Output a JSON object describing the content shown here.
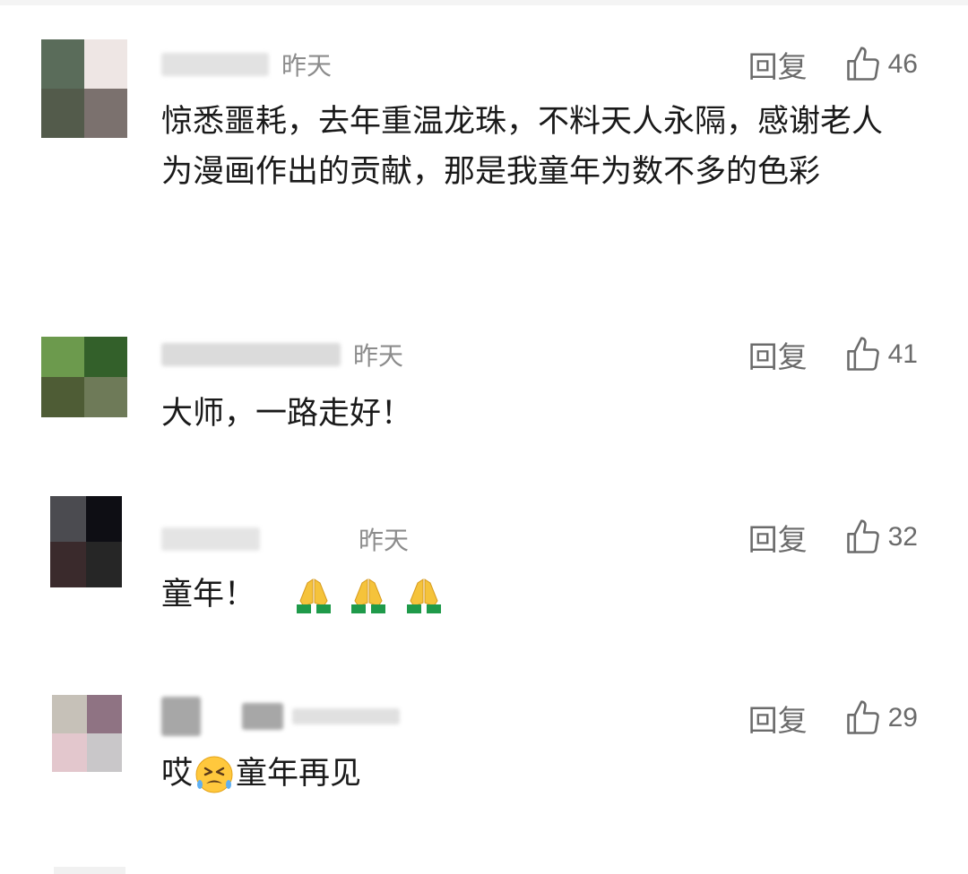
{
  "comments": [
    {
      "time": "昨天",
      "text": "惊悉噩耗，去年重温龙珠，不料天人永隔，感谢老人为漫画作出的贡献，那是我童年为数不多的色彩",
      "reply_label": "回复",
      "like_count": "46",
      "avatar_colors": [
        "#5f6a58",
        "#e9e4e0",
        "#525a4c",
        "#7a716e"
      ]
    },
    {
      "time": "昨天",
      "text": "大师，一路走好！",
      "reply_label": "回复",
      "like_count": "41",
      "avatar_colors": [
        "#6d9a4e",
        "#34602a",
        "#4f5d36",
        "#6d7a58"
      ]
    },
    {
      "time": "昨天",
      "text": "童年！",
      "emojis": [
        "folded-hands-icon",
        "folded-hands-icon",
        "folded-hands-icon"
      ],
      "reply_label": "回复",
      "like_count": "32",
      "avatar_colors": [
        "#4a4a4e",
        "#0e0e14",
        "#3a2a2c",
        "#262626"
      ]
    },
    {
      "time": "",
      "text_prefix": "哎",
      "text_suffix": "童年再见",
      "emojis": [
        "tired-face-icon"
      ],
      "reply_label": "回复",
      "like_count": "29",
      "avatar_colors": [
        "#c6c1b8",
        "#8f7383",
        "#e3c7cd",
        "#c9c7c9"
      ]
    }
  ],
  "colors": {
    "text": "#1a1a1a",
    "meta": "#8c8c8c",
    "action": "#6b6b6b"
  }
}
